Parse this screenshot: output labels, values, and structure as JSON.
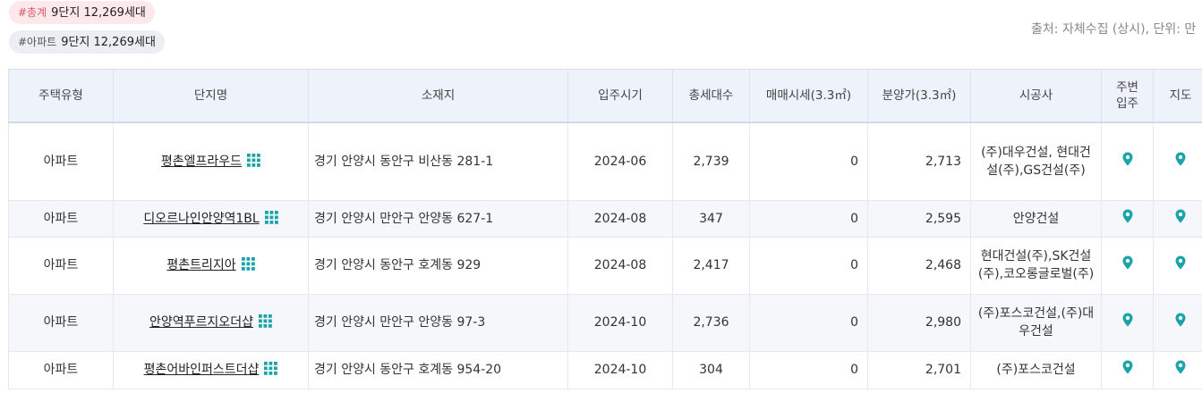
{
  "tags": {
    "total": {
      "label": "#총계",
      "value": "9단지 12,269세대"
    },
    "apartment": {
      "label": "#아파트",
      "value": "9단지 12,269세대"
    }
  },
  "source": "출처: 자체수집 (상시), 단위: 만",
  "table": {
    "headers": {
      "type": "주택유형",
      "name": "단지명",
      "address": "소재지",
      "move_in": "입주시기",
      "households": "총세대수",
      "trade_price": "매매시세(3.3㎡)",
      "sale_price": "분양가(3.3㎡)",
      "builder": "시공사",
      "nearby_line1": "주변",
      "nearby_line2": "입주",
      "map": "지도"
    },
    "rows": [
      {
        "type": "아파트",
        "name": "평촌엘프라우드",
        "address": "경기 안양시 동안구 비산동 281-1",
        "move_in": "2024-06",
        "households": "2,739",
        "trade_price": "0",
        "sale_price": "2,713",
        "builder": "(주)대우건설, 현대건설(주),GS건설(주)"
      },
      {
        "type": "아파트",
        "name": "디오르나인안양역1BL",
        "address": "경기 안양시 만안구 안양동 627-1",
        "move_in": "2024-08",
        "households": "347",
        "trade_price": "0",
        "sale_price": "2,595",
        "builder": "안양건설"
      },
      {
        "type": "아파트",
        "name": "평촌트리지아",
        "address": "경기 안양시 동안구 호계동 929",
        "move_in": "2024-08",
        "households": "2,417",
        "trade_price": "0",
        "sale_price": "2,468",
        "builder": "현대건설(주),SK건설(주),코오롱글로벌(주)"
      },
      {
        "type": "아파트",
        "name": "안양역푸르지오더샵",
        "address": "경기 안양시 만안구 안양동 97-3",
        "move_in": "2024-10",
        "households": "2,736",
        "trade_price": "0",
        "sale_price": "2,980",
        "builder": "(주)포스코건설,(주)대우건설"
      },
      {
        "type": "아파트",
        "name": "평촌어바인퍼스트더샵",
        "address": "경기 안양시 동안구 호계동 954-20",
        "move_in": "2024-10",
        "households": "304",
        "trade_price": "0",
        "sale_price": "2,701",
        "builder": "(주)포스코건설"
      }
    ]
  },
  "colors": {
    "accent": "#1aa3a8",
    "header_bg": "#eef2fb",
    "tag_total_bg": "#fde8ec",
    "tag_total_text": "#d8576e"
  },
  "icons": {
    "complex": "grid-icon",
    "nearby": "map-pin-icon",
    "map": "map-pin-icon"
  }
}
